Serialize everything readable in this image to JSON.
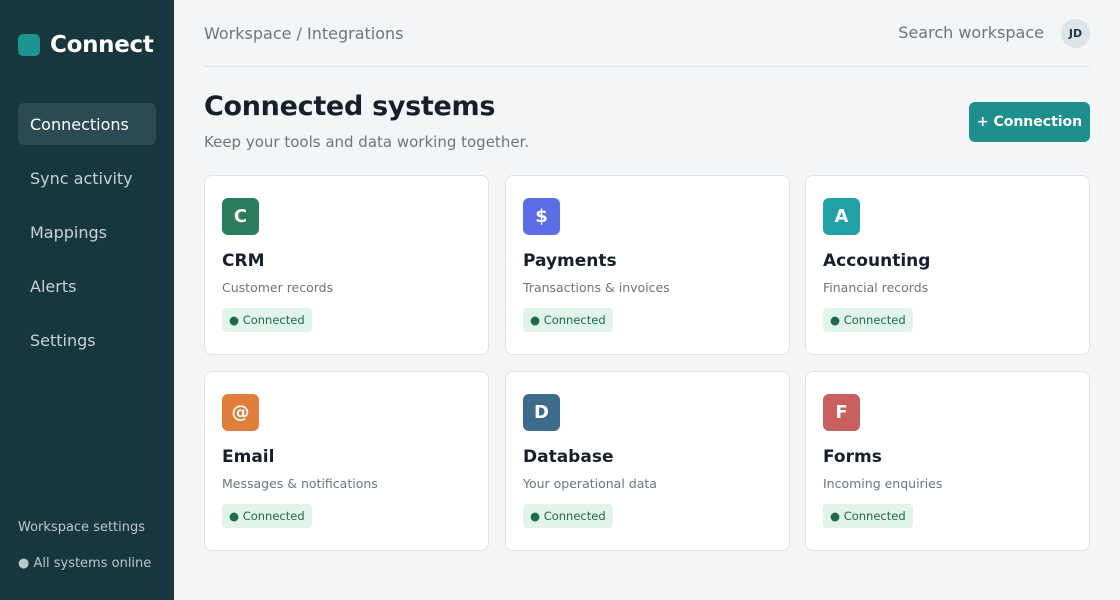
{
  "brand": {
    "name": "Connect",
    "accent": "#1c9490"
  },
  "sidebar": {
    "items": [
      {
        "label": "Connections",
        "active": true
      },
      {
        "label": "Sync activity",
        "active": false
      },
      {
        "label": "Mappings",
        "active": false
      },
      {
        "label": "Alerts",
        "active": false
      },
      {
        "label": "Settings",
        "active": false
      }
    ],
    "workspace_settings": "Workspace settings",
    "status": "● All systems online"
  },
  "header": {
    "breadcrumb": "Workspace / Integrations",
    "search_label": "Search workspace",
    "avatar_initials": "JD"
  },
  "page": {
    "title": "Connected systems",
    "subtitle": "Keep your tools and data working together.",
    "add_button": "+ Connection"
  },
  "cards": [
    {
      "icon": "C",
      "icon_color": "#2a7c5c",
      "title": "CRM",
      "desc": "Customer records",
      "status": "● Connected"
    },
    {
      "icon": "$",
      "icon_color": "#5c6ee6",
      "title": "Payments",
      "desc": "Transactions & invoices",
      "status": "● Connected"
    },
    {
      "icon": "A",
      "icon_color": "#21a1a6",
      "title": "Accounting",
      "desc": "Financial records",
      "status": "● Connected"
    },
    {
      "icon": "@",
      "icon_color": "#e07f3c",
      "title": "Email",
      "desc": "Messages & notifications",
      "status": "● Connected"
    },
    {
      "icon": "D",
      "icon_color": "#3e6a8c",
      "title": "Database",
      "desc": "Your operational data",
      "status": "● Connected"
    },
    {
      "icon": "F",
      "icon_color": "#c96060",
      "title": "Forms",
      "desc": "Incoming enquiries",
      "status": "● Connected"
    }
  ]
}
